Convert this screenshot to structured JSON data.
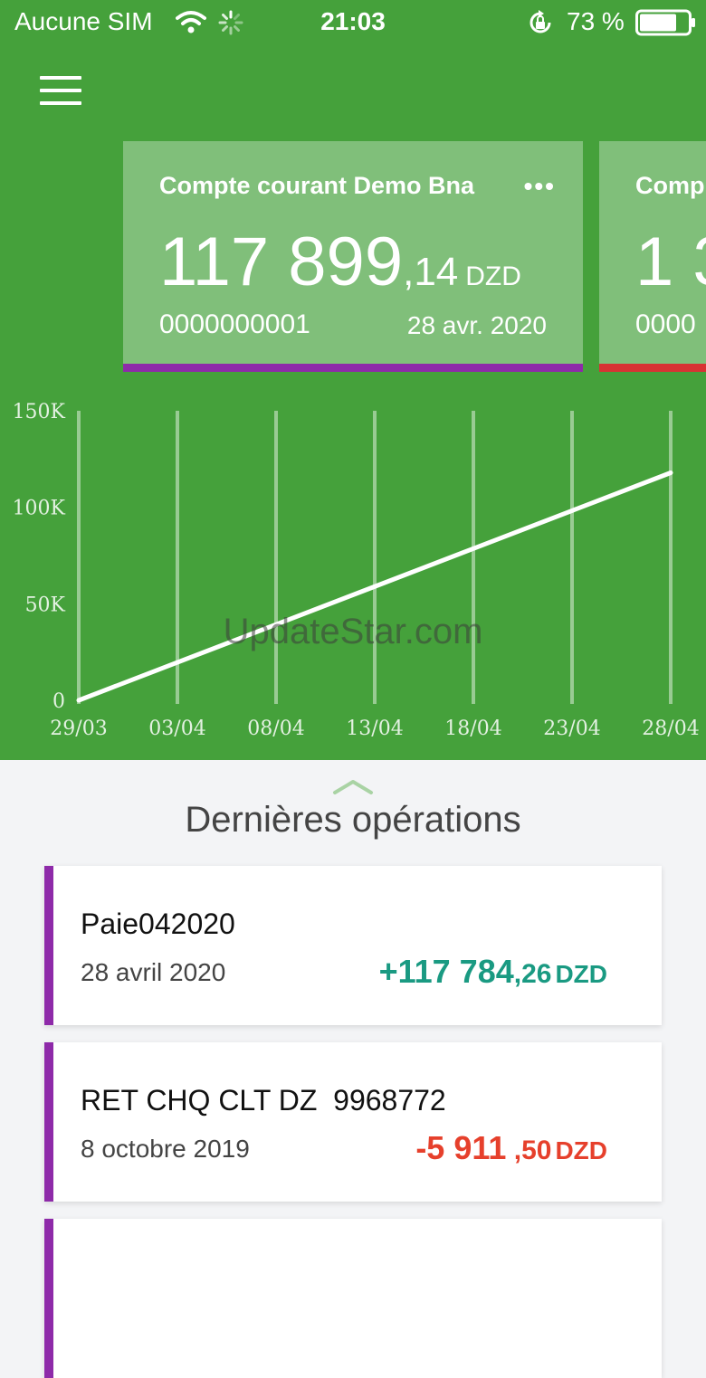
{
  "status_bar": {
    "carrier": "Aucune SIM",
    "time": "21:03",
    "battery": "73 %"
  },
  "accounts": [
    {
      "name": "Compte courant Demo Bna",
      "balance_int": "117 899",
      "balance_dec": ",14",
      "currency": "DZD",
      "number": "0000000001",
      "date": "28 avr. 2020",
      "color": "#8e2aa9"
    },
    {
      "name": "Comp",
      "balance_int": "1 3",
      "number": "0000",
      "color": "#d83333"
    }
  ],
  "chart_data": {
    "type": "line",
    "x": [
      "29/03",
      "03/04",
      "08/04",
      "13/04",
      "18/04",
      "23/04",
      "28/04"
    ],
    "y_ticks": [
      "0",
      "50K",
      "100K",
      "150K"
    ],
    "ylim": [
      0,
      150000
    ],
    "series": [
      {
        "values": [
          0,
          19650,
          39300,
          58950,
          78600,
          98250,
          117899
        ]
      }
    ],
    "grid": "vertical"
  },
  "watermark": "UpdateStar.com",
  "operations_section": {
    "title": "Dernières opérations",
    "items": [
      {
        "label": "Paie042020",
        "date": "28 avril 2020",
        "amount_int": "+117 784",
        "amount_dec": ",26",
        "currency": "DZD",
        "color": "#1a9a82"
      },
      {
        "label": "RET CHQ CLT DZ  9968772",
        "date": "8 octobre 2019",
        "amount_int": "-5 911",
        "amount_dec": " ,50",
        "currency": "DZD",
        "color": "#e6402c"
      }
    ]
  },
  "colors": {
    "header_green": "#45a13b",
    "card_accent_purple": "#8e2aa9",
    "card_accent_red": "#d83333"
  }
}
